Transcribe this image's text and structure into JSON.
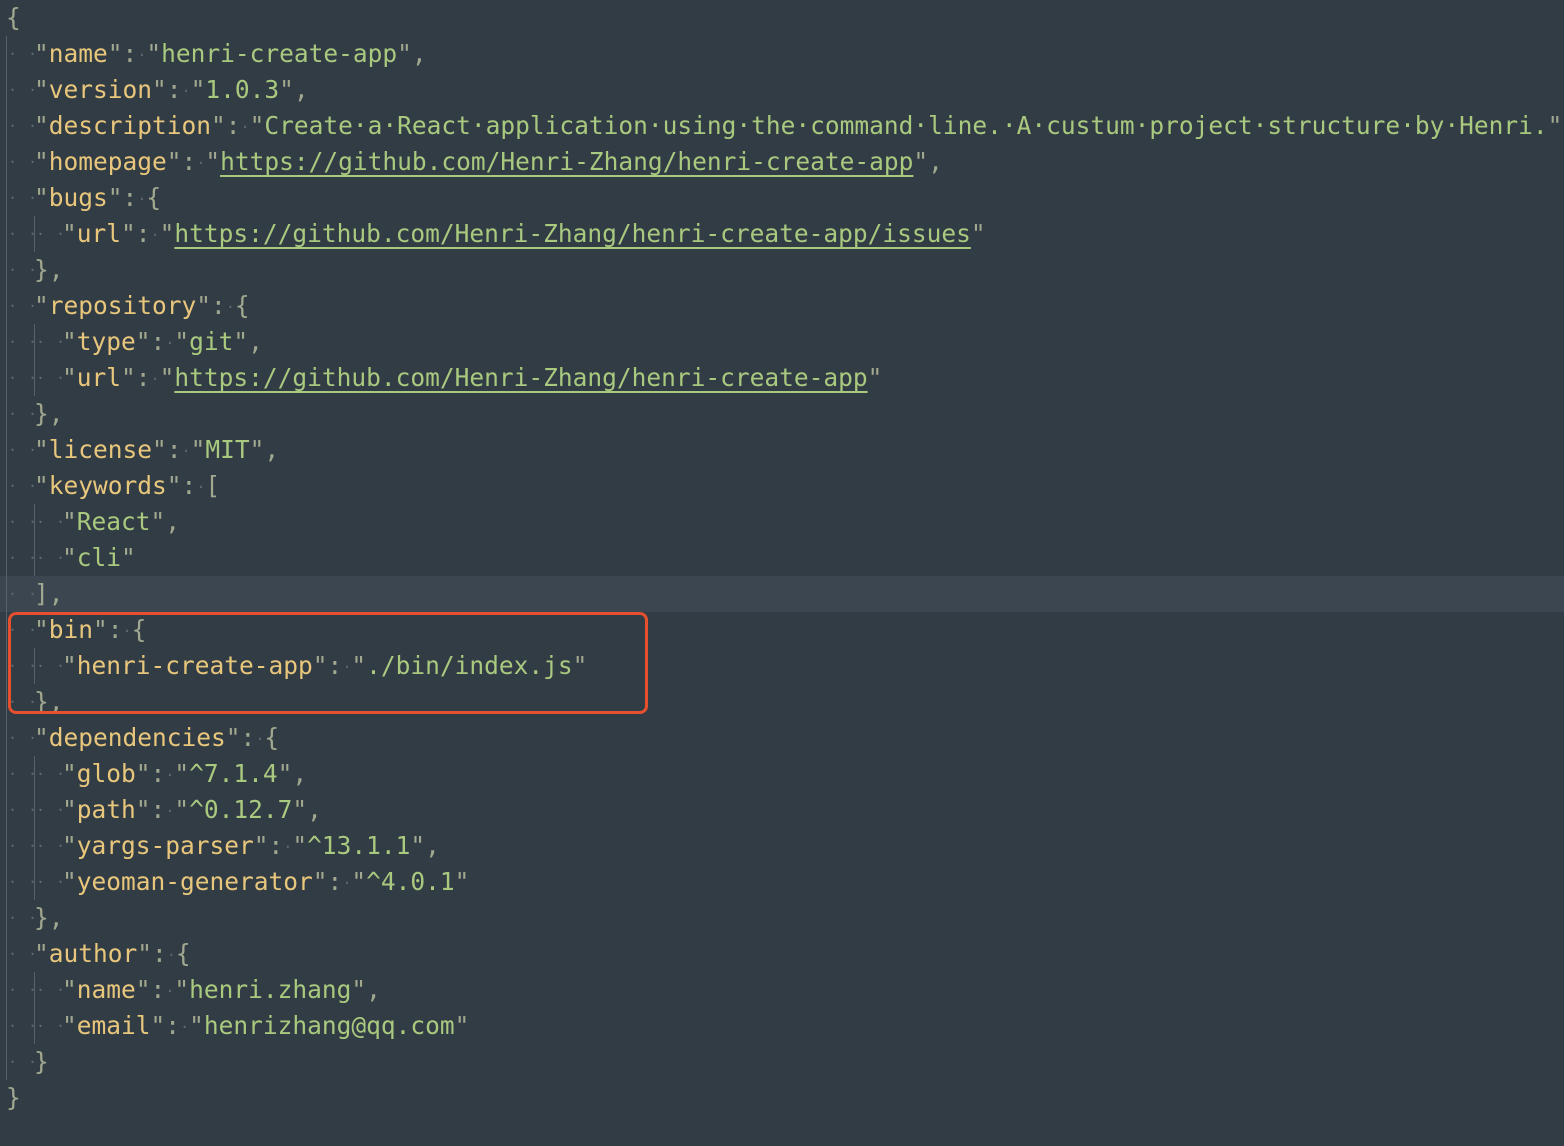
{
  "root_open": "{",
  "root_close": "}",
  "name": {
    "key": "name",
    "value": "henri-create-app"
  },
  "version": {
    "key": "version",
    "value": "1.0.3"
  },
  "description": {
    "key": "description",
    "value": "Create·a·React·application·using·the·command·line.·A·custum·project·structure·by·Henri."
  },
  "homepage": {
    "key": "homepage",
    "value": "https://github.com/Henri-Zhang/henri-create-app"
  },
  "bugs": {
    "key": "bugs",
    "url_key": "url",
    "url_value": "https://github.com/Henri-Zhang/henri-create-app/issues"
  },
  "repository": {
    "key": "repository",
    "type_key": "type",
    "type_value": "git",
    "url_key": "url",
    "url_value": "https://github.com/Henri-Zhang/henri-create-app"
  },
  "license": {
    "key": "license",
    "value": "MIT"
  },
  "keywords": {
    "key": "keywords",
    "items": [
      "React",
      "cli"
    ]
  },
  "bin": {
    "key": "bin",
    "entry_key": "henri-create-app",
    "entry_value": "./bin/index.js"
  },
  "dependencies": {
    "key": "dependencies",
    "items": [
      {
        "name": "glob",
        "version": "^7.1.4"
      },
      {
        "name": "path",
        "version": "^0.12.7"
      },
      {
        "name": "yargs-parser",
        "version": "^13.1.1"
      },
      {
        "name": "yeoman-generator",
        "version": "^4.0.1"
      }
    ]
  },
  "author": {
    "key": "author",
    "name_key": "name",
    "name_value": "henri.zhang",
    "email_key": "email",
    "email_value": "henrizhang@qq.com"
  },
  "colors": {
    "background": "#323c45",
    "current_line": "#3c4650",
    "key": "#e8c77c",
    "string": "#a9c97f",
    "punctuation": "#a2a890",
    "highlight_box": "#e6502e"
  }
}
